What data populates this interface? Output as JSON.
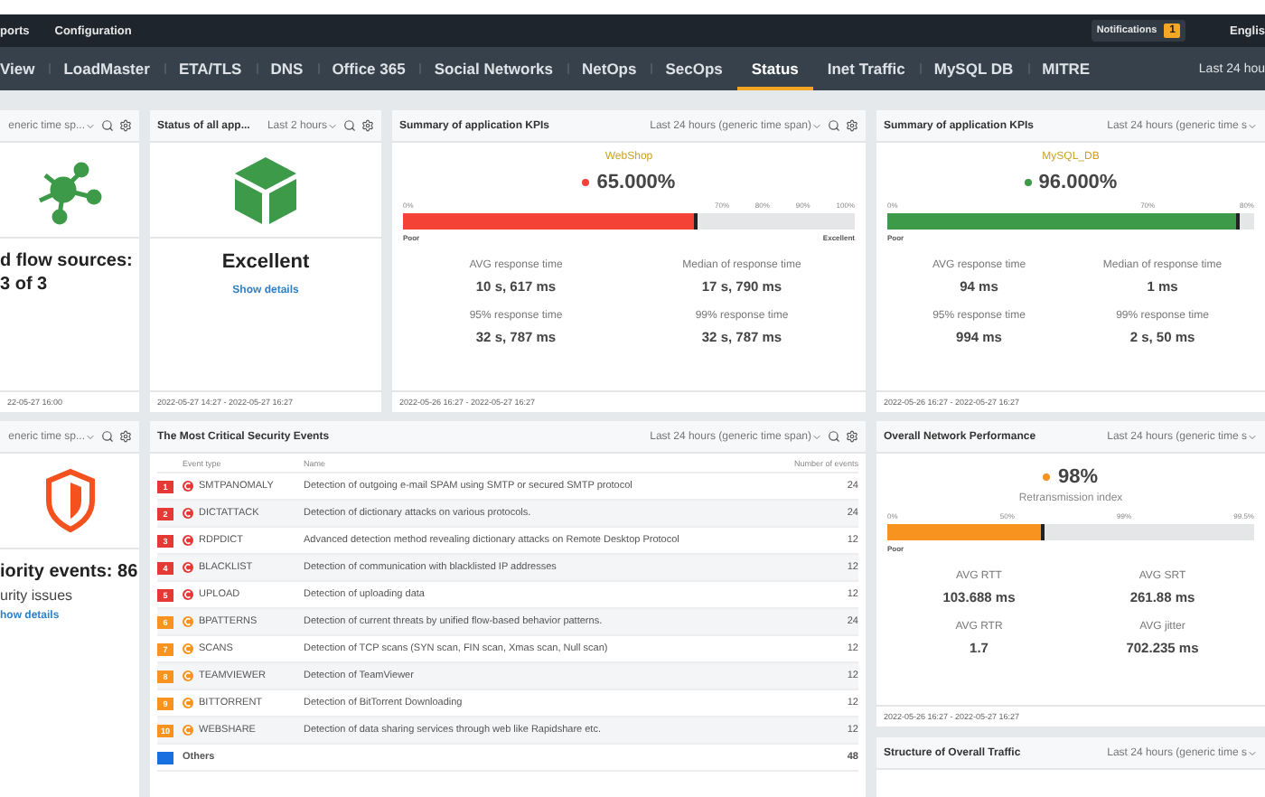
{
  "top_bar": {
    "menu": [
      "ports",
      "Configuration"
    ],
    "notifications": {
      "label": "Notifications",
      "count": "1"
    },
    "language": "Englis"
  },
  "tabs": [
    {
      "label": "View",
      "selected": false
    },
    {
      "label": "LoadMaster",
      "selected": false
    },
    {
      "label": "ETA/TLS",
      "selected": false
    },
    {
      "label": "DNS",
      "selected": false
    },
    {
      "label": "Office 365",
      "selected": false
    },
    {
      "label": "Social Networks",
      "selected": false
    },
    {
      "label": "NetOps",
      "selected": false
    },
    {
      "label": "SecOps",
      "selected": false
    },
    {
      "label": "Status",
      "selected": true
    },
    {
      "label": "Inet Traffic",
      "selected": false
    },
    {
      "label": "MySQL DB",
      "selected": false
    },
    {
      "label": "MITRE",
      "selected": false
    }
  ],
  "time_range": "Last 24 hou",
  "flow_card": {
    "time_span": "eneric time sp...",
    "headline": "d flow sources:",
    "count": "3 of 3",
    "footer": "22-05-27 16:00"
  },
  "status_card": {
    "title": "Status of all app...",
    "time_span": "Last 2 hours",
    "status": "Excellent",
    "link": "Show details",
    "footer": "2022-05-27 14:27 - 2022-05-27 16:27"
  },
  "kpi_cards": [
    {
      "title": "Summary of application KPIs",
      "time_span": "Last 24 hours (generic time span)",
      "app": "WebShop",
      "color": "#f44336",
      "value": "65.000%",
      "level": 0.65,
      "ticks": [
        "0%",
        "70%",
        "80%",
        "90%",
        "100%"
      ],
      "low_label": "Poor",
      "high_label": "Excellent",
      "metrics": [
        {
          "label": "AVG response time",
          "value": "10 s, 617 ms"
        },
        {
          "label": "Median of response time",
          "value": "17 s, 790 ms"
        },
        {
          "label": "95% response time",
          "value": "32 s, 787 ms"
        },
        {
          "label": "99% response time",
          "value": "32 s, 787 ms"
        }
      ],
      "footer": "2022-05-26 16:27 - 2022-05-27 16:27"
    },
    {
      "title": "Summary of application KPIs",
      "time_span": "Last 24 hours (generic time s",
      "app": "MySQL_DB",
      "color": "#3d9a48",
      "value": "96.000%",
      "level": 0.96,
      "ticks": [
        "0%",
        "70%",
        "80%"
      ],
      "low_label": "Poor",
      "metrics": [
        {
          "label": "AVG response time",
          "value": "94 ms"
        },
        {
          "label": "Median of response time",
          "value": "1 ms"
        },
        {
          "label": "95% response time",
          "value": "994 ms"
        },
        {
          "label": "99% response time",
          "value": "2 s, 50 ms"
        }
      ],
      "footer": "2022-05-26 16:27 - 2022-05-27 16:27"
    }
  ],
  "security_card": {
    "time_span": "eneric time sp...",
    "headline": "iority events: 86",
    "subline": "urity issues",
    "link": "how details"
  },
  "events_card": {
    "title": "The Most Critical Security Events",
    "time_span": "Last 24 hours (generic time span)",
    "columns": [
      "Event type",
      "Name",
      "Number of events"
    ],
    "rows": [
      {
        "kind": "event",
        "rank": "1",
        "color": "#e53935",
        "type": "SMTPANOMALY",
        "name": "Detection of outgoing e-mail SPAM using SMTP or secured SMTP protocol",
        "count": "24"
      },
      {
        "kind": "event",
        "rank": "2",
        "color": "#e53935",
        "type": "DICTATTACK",
        "name": "Detection of dictionary attacks on various protocols.",
        "count": "24"
      },
      {
        "kind": "event",
        "rank": "3",
        "color": "#e53935",
        "type": "RDPDICT",
        "name": "Advanced detection method revealing dictionary attacks on Remote Desktop Protocol",
        "count": "12"
      },
      {
        "kind": "event",
        "rank": "4",
        "color": "#e53935",
        "type": "BLACKLIST",
        "name": "Detection of communication with blacklisted IP addresses",
        "count": "12"
      },
      {
        "kind": "event",
        "rank": "5",
        "color": "#e53935",
        "type": "UPLOAD",
        "name": "Detection of uploading data",
        "count": "12"
      },
      {
        "kind": "event",
        "rank": "6",
        "color": "#f7931e",
        "type": "BPATTERNS",
        "name": "Detection of current threats by unified flow-based behavior patterns.",
        "count": "24"
      },
      {
        "kind": "event",
        "rank": "7",
        "color": "#f7931e",
        "type": "SCANS",
        "name": "Detection of TCP scans (SYN scan, FIN scan, Xmas scan, Null scan)",
        "count": "12"
      },
      {
        "kind": "event",
        "rank": "8",
        "color": "#f7931e",
        "type": "TEAMVIEWER",
        "name": "Detection of TeamViewer",
        "count": "12"
      },
      {
        "kind": "event",
        "rank": "9",
        "color": "#f7931e",
        "type": "BITTORRENT",
        "name": "Detection of BitTorrent Downloading",
        "count": "12"
      },
      {
        "kind": "event",
        "rank": "10",
        "color": "#f7931e",
        "type": "WEBSHARE",
        "name": "Detection of data sharing services through web like Rapidshare etc.",
        "count": "12"
      },
      {
        "kind": "others",
        "color": "#1a6fe0",
        "type": "Others",
        "count": "48"
      }
    ]
  },
  "network_card": {
    "title": "Overall Network Performance",
    "time_span": "Last 24 hours (generic time s",
    "color": "#f7931e",
    "value": "98%",
    "caption": "Retransmission index",
    "level": 0.43,
    "ticks": [
      "0%",
      "50%",
      "99%",
      "99.5%"
    ],
    "low_label": "Poor",
    "metrics": [
      {
        "label": "AVG RTT",
        "value": "103.688 ms"
      },
      {
        "label": "AVG SRT",
        "value": "261.88 ms"
      },
      {
        "label": "AVG RTR",
        "value": "1.7"
      },
      {
        "label": "AVG jitter",
        "value": "702.235 ms"
      }
    ],
    "footer": "2022-05-26 16:27 - 2022-05-27 16:27"
  },
  "structure_card": {
    "title": "Structure of Overall Traffic",
    "time_span": "Last 24 hours (generic time s"
  }
}
